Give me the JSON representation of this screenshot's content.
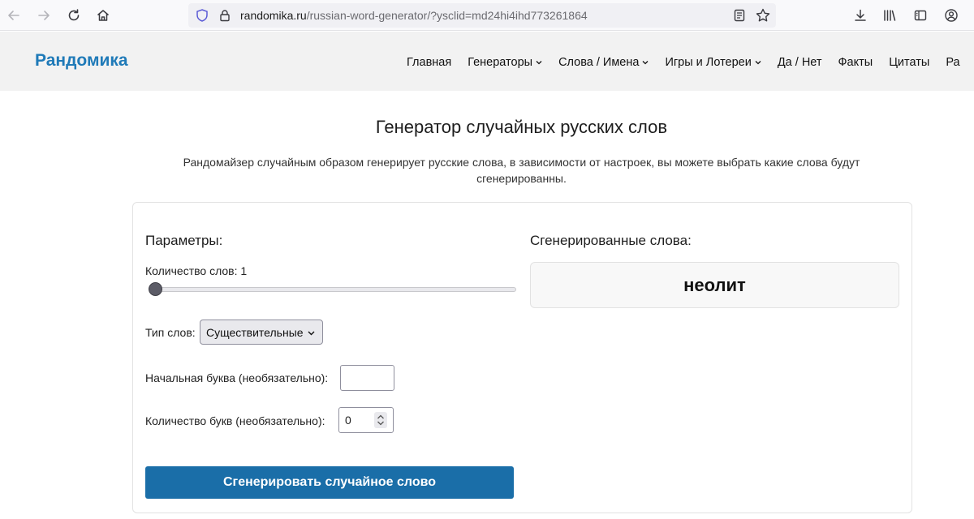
{
  "browser": {
    "url_domain": "randomika.ru",
    "url_path": "/russian-word-generator/?ysclid=md24hi4ihd773261864"
  },
  "site": {
    "logo": "Рандомика",
    "menu": [
      {
        "label": "Главная",
        "dropdown": false
      },
      {
        "label": "Генераторы",
        "dropdown": true
      },
      {
        "label": "Слова / Имена",
        "dropdown": true
      },
      {
        "label": "Игры и Лотереи",
        "dropdown": true
      },
      {
        "label": "Да / Нет",
        "dropdown": false
      },
      {
        "label": "Факты",
        "dropdown": false
      },
      {
        "label": "Цитаты",
        "dropdown": false
      },
      {
        "label": "Ра",
        "dropdown": false
      }
    ]
  },
  "page": {
    "title": "Генератор случайных русских слов",
    "description": "Рандомайзер случайным образом генерирует русские слова, в зависимости от настроек, вы можете выбрать какие слова будут сгенерированны."
  },
  "params": {
    "title": "Параметры:",
    "count_label": "Количество слов: 1",
    "count_value": 1,
    "type_label": "Тип слов:",
    "type_selected": "Существительные",
    "letter_label": "Начальная буква (необязательно):",
    "letter_value": "",
    "length_label": "Количество букв (необязательно):",
    "length_value": "0",
    "generate_button": "Сгенерировать случайное слово"
  },
  "result": {
    "title": "Сгенерированные слова:",
    "word": "неолит"
  },
  "colors": {
    "accent": "#1f7ab8",
    "button": "#1a6ea8"
  }
}
